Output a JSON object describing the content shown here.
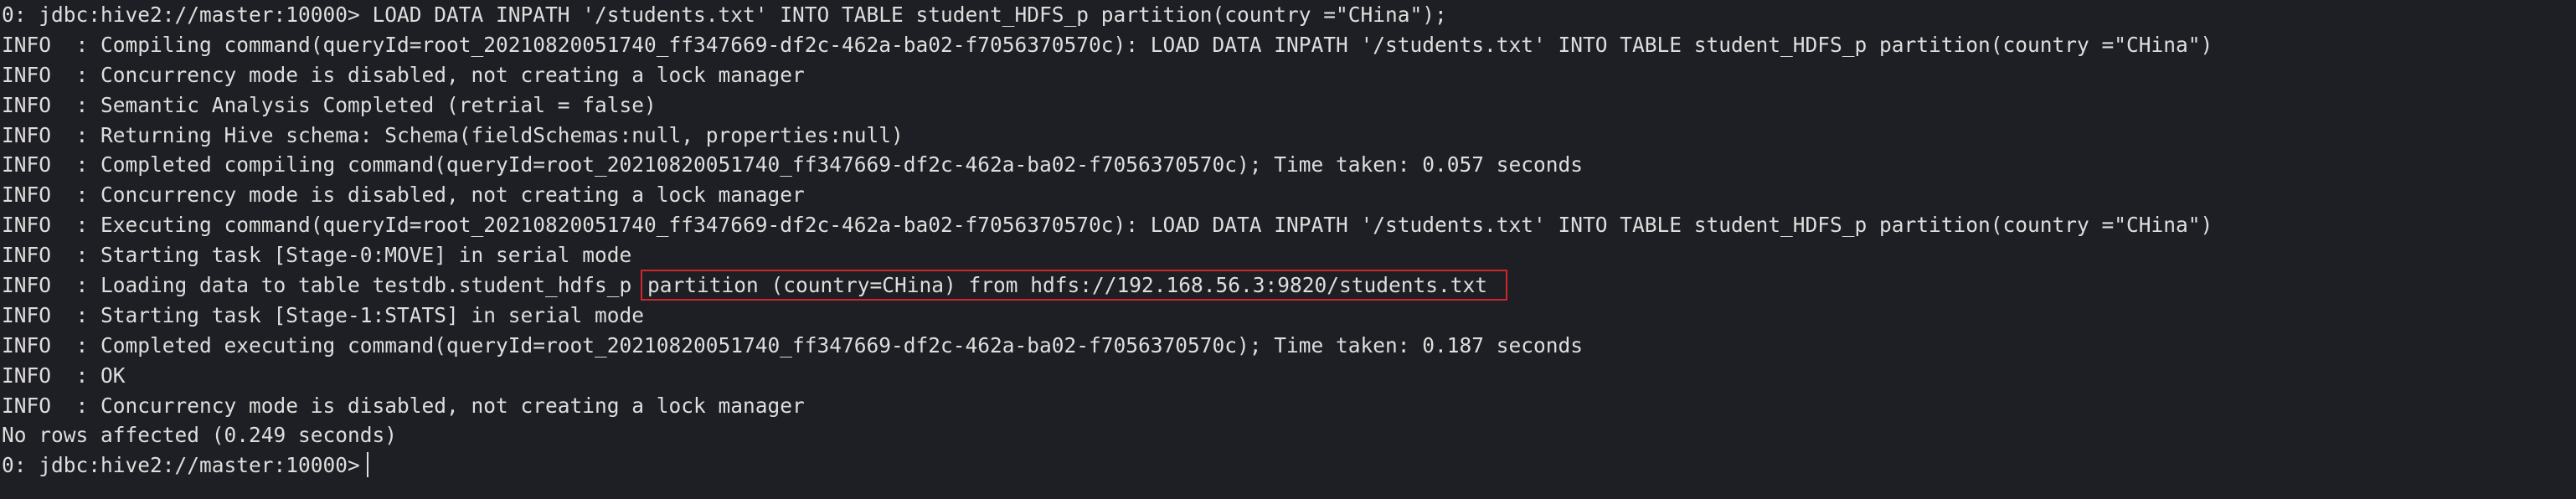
{
  "lines": [
    "0: jdbc:hive2://master:10000> LOAD DATA INPATH '/students.txt' INTO TABLE student_HDFS_p partition(country =\"CHina\");",
    "INFO  : Compiling command(queryId=root_20210820051740_ff347669-df2c-462a-ba02-f7056370570c): LOAD DATA INPATH '/students.txt' INTO TABLE student_HDFS_p partition(country =\"CHina\")",
    "INFO  : Concurrency mode is disabled, not creating a lock manager",
    "INFO  : Semantic Analysis Completed (retrial = false)",
    "INFO  : Returning Hive schema: Schema(fieldSchemas:null, properties:null)",
    "INFO  : Completed compiling command(queryId=root_20210820051740_ff347669-df2c-462a-ba02-f7056370570c); Time taken: 0.057 seconds",
    "INFO  : Concurrency mode is disabled, not creating a lock manager",
    "INFO  : Executing command(queryId=root_20210820051740_ff347669-df2c-462a-ba02-f7056370570c): LOAD DATA INPATH '/students.txt' INTO TABLE student_HDFS_p partition(country =\"CHina\")",
    "INFO  : Starting task [Stage-0:MOVE] in serial mode",
    {
      "prefix": "INFO  : Loading data to table testdb.student_hdfs_p ",
      "highlight": "partition (country=CHina) from hdfs://192.168.56.3:9820/students.txt"
    },
    "INFO  : Starting task [Stage-1:STATS] in serial mode",
    "INFO  : Completed executing command(queryId=root_20210820051740_ff347669-df2c-462a-ba02-f7056370570c); Time taken: 0.187 seconds",
    "INFO  : OK",
    "INFO  : Concurrency mode is disabled, not creating a lock manager",
    "No rows affected (0.249 seconds)"
  ],
  "prompt": "0: jdbc:hive2://master:10000>",
  "colors": {
    "background": "#1e1f24",
    "text": "#dedede",
    "highlight_box": "#d0262a"
  }
}
